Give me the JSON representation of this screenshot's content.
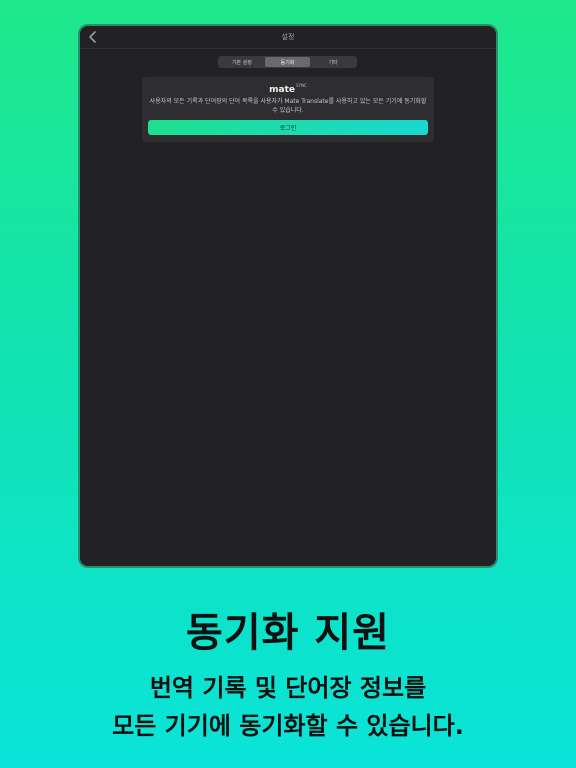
{
  "colors": {
    "background_top": "#1ee88a",
    "background_bottom": "#0ae3d9",
    "screen_bg": "#222224",
    "card_bg": "#2e2e31",
    "login_button": "#1fe08f"
  },
  "topbar": {
    "back_icon": "chevron-left-icon",
    "title": "설정"
  },
  "tabs": [
    {
      "label": "기본 설정",
      "active": false
    },
    {
      "label": "동기화",
      "active": true
    },
    {
      "label": "기타",
      "active": false
    }
  ],
  "sync_card": {
    "brand": "mate",
    "brand_sup": "SYNC",
    "description": "사용자의 모든 기록과 단어장의 단어 목록을 사용자가 Mate Translate를 사용하고 있는 모든 기기에 동기화할 수 있습니다.",
    "login_label": "로그인"
  },
  "promo": {
    "headline": "동기화 지원",
    "line1": "번역 기록 및 단어장 정보를",
    "line2": "모든 기기에 동기화할 수 있습니다."
  }
}
